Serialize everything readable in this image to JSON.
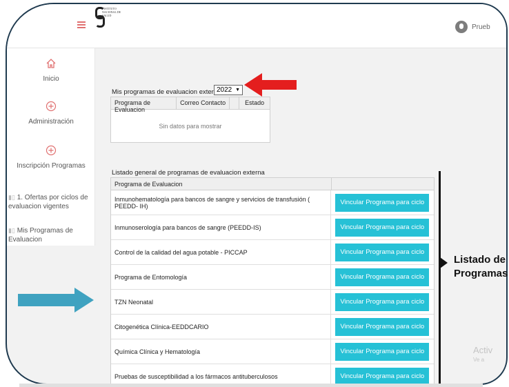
{
  "header": {
    "logo_lines": [
      "INSTITUTO",
      "NACIONAL DE",
      "SALUD"
    ],
    "user_name": "Prueb"
  },
  "sidebar": {
    "items": [
      {
        "label": "Inicio",
        "icon": "home-icon"
      },
      {
        "label": "Administración",
        "icon": "plus-circle-icon"
      },
      {
        "label": "Inscripción Programas",
        "icon": "plus-circle-icon"
      }
    ],
    "sub_items": [
      {
        "label": "1. Ofertas por ciclos de evaluacion vigentes",
        "icon": "bar-chart-icon"
      },
      {
        "label": "Mis Programas de Evaluacion",
        "icon": "bar-chart-icon"
      }
    ]
  },
  "mis_programas": {
    "label": "Mis programas de evaluacion externa",
    "year_selected": "2022",
    "columns": [
      "Programa de Evaluacion",
      "Correo Contacto",
      "",
      "Estado"
    ],
    "empty_text": "Sin datos para mostrar"
  },
  "listado": {
    "label": "Listado general de programas de evaluacion externa",
    "column": "Programa de Evaluacion",
    "button_label": "Vincular Programa para ciclo",
    "rows": [
      "Inmunohematología para bancos de sangre y servicios de transfusión ( PEEDD- IH)",
      "Inmunoserología para bancos de sangre (PEEDD-IS)",
      "Control de la calidad del agua potable - PICCAP",
      "Programa de Entomología",
      "TZN Neonatal",
      "Citogenética Clínica-EEDDCARIO",
      "Química Clínica y Hematología",
      "Pruebas de susceptibilidad a los fármacos antituberculosos"
    ]
  },
  "annotation": {
    "callout_line1": "Listado de",
    "callout_line2": "Programas",
    "red_arrow_color": "#e41e1e",
    "blue_arrow_color": "#3fa2c0"
  },
  "watermark": {
    "line1": "Activ",
    "line2": "Ve a"
  },
  "colors": {
    "button": "#26c1d6",
    "accent": "#e07070"
  }
}
